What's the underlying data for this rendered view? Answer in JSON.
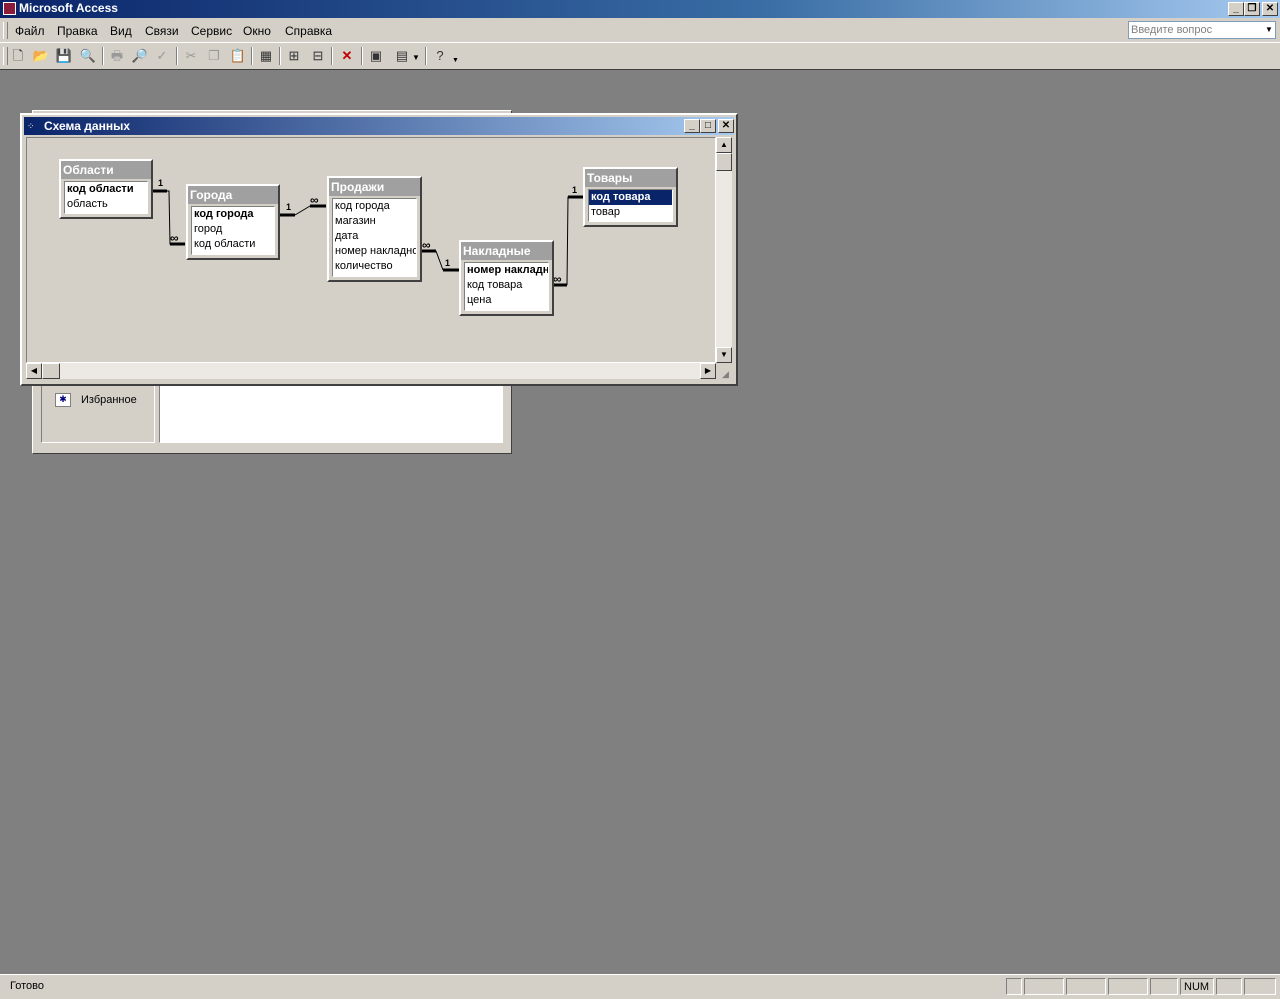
{
  "app": {
    "title": "Microsoft Access"
  },
  "menu": {
    "items": [
      "Файл",
      "Правка",
      "Вид",
      "Связи",
      "Сервис",
      "Окно",
      "Справка"
    ],
    "ask_placeholder": "Введите вопрос"
  },
  "toolbar": {
    "icons": [
      "new-icon",
      "open-icon",
      "save-icon",
      "search-icon",
      "print-icon",
      "print-preview-icon",
      "spelling-icon",
      "cut-icon",
      "copy-icon",
      "paste-icon",
      "show-table-icon",
      "show-direct-icon",
      "show-all-icon",
      "delete-icon",
      "database-window-icon",
      "new-object-icon",
      "help-icon"
    ]
  },
  "database_window": {
    "favorites_label": "Избранное"
  },
  "relationships_window": {
    "title": "Схема данных",
    "tables": [
      {
        "name": "Области",
        "fields": [
          {
            "name": "код области",
            "pk": true
          },
          {
            "name": "область"
          }
        ]
      },
      {
        "name": "Города",
        "fields": [
          {
            "name": "код города",
            "pk": true
          },
          {
            "name": "город"
          },
          {
            "name": "код области"
          }
        ]
      },
      {
        "name": "Продажи",
        "fields": [
          {
            "name": "код города"
          },
          {
            "name": "магазин"
          },
          {
            "name": "дата"
          },
          {
            "name": "номер накладно"
          },
          {
            "name": "количество"
          }
        ]
      },
      {
        "name": "Накладные",
        "fields": [
          {
            "name": "номер накладно",
            "pk": true
          },
          {
            "name": "код товара"
          },
          {
            "name": "цена"
          }
        ]
      },
      {
        "name": "Товары",
        "fields": [
          {
            "name": "код товара",
            "pk": true,
            "selected": true
          },
          {
            "name": "товар"
          }
        ]
      }
    ],
    "relationships": [
      {
        "from": "Области",
        "to": "Города",
        "one": "1",
        "many": "∞"
      },
      {
        "from": "Города",
        "to": "Продажи",
        "one": "1",
        "many": "∞"
      },
      {
        "from": "Накладные",
        "to": "Продажи",
        "one": "1",
        "many": "∞"
      },
      {
        "from": "Товары",
        "to": "Накладные",
        "one": "1",
        "many": "∞"
      }
    ]
  },
  "statusbar": {
    "message": "Готово",
    "num": "NUM"
  }
}
